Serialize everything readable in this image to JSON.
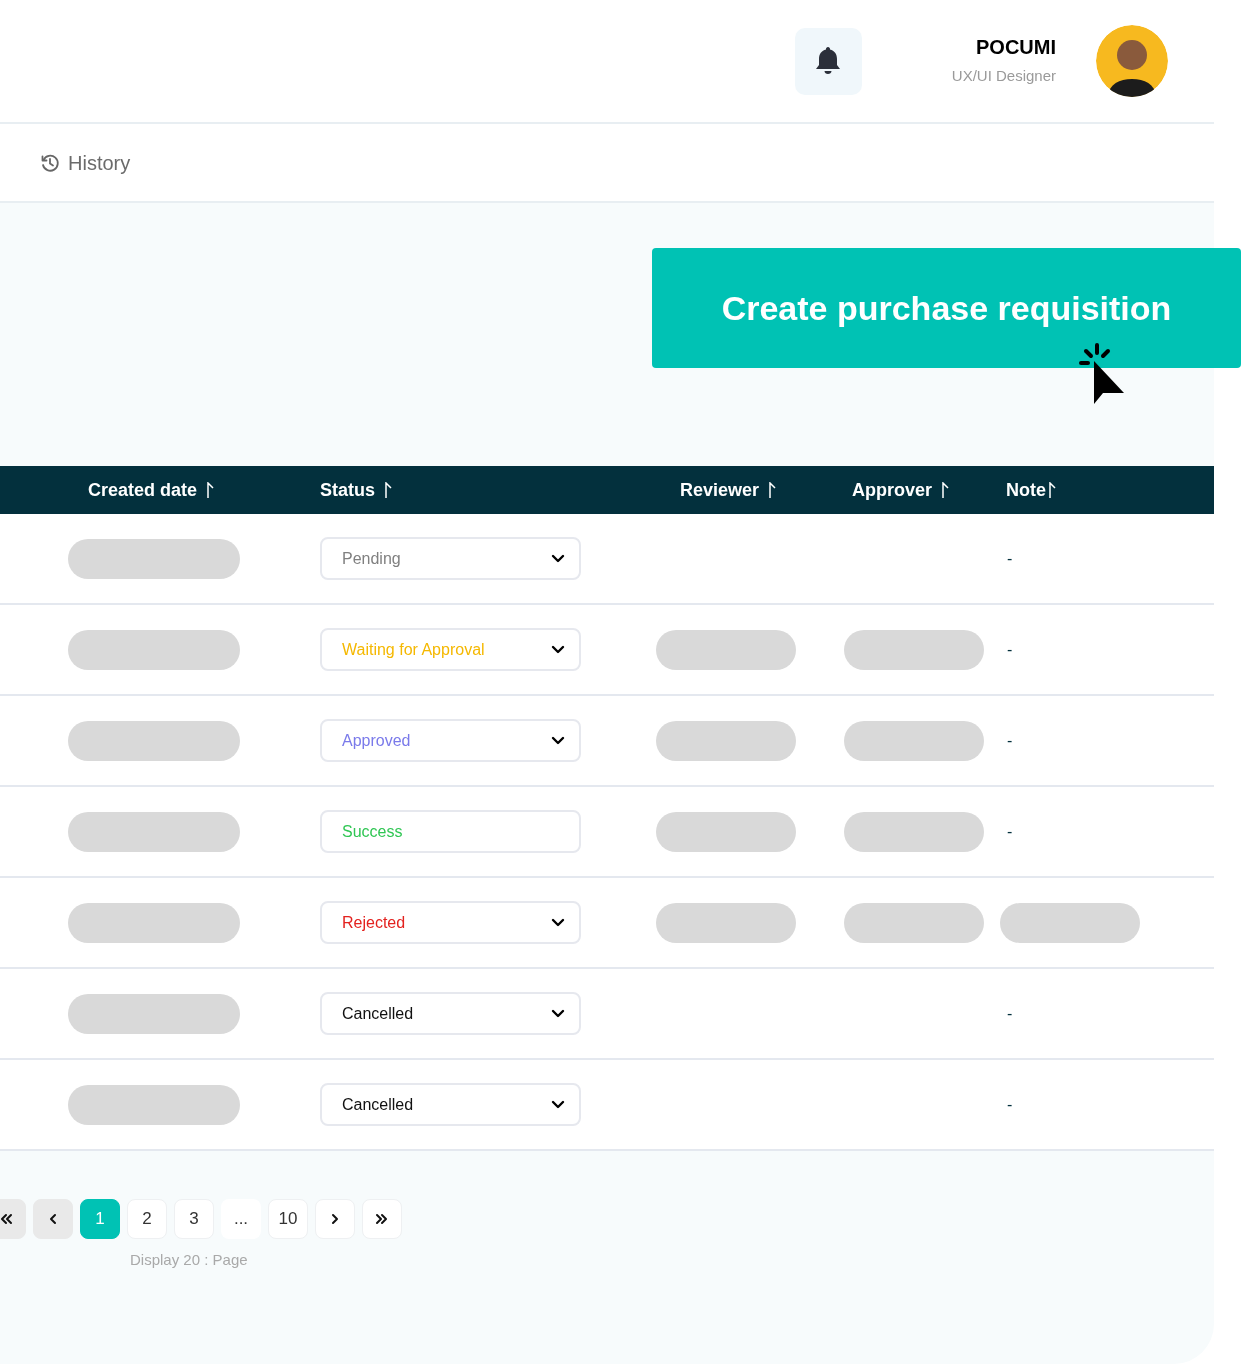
{
  "header": {
    "user_name": "POCUMI",
    "user_role": "UX/UI Designer"
  },
  "breadcrumb": {
    "label": "History"
  },
  "create_button": {
    "label": "Create purchase requisition"
  },
  "table": {
    "columns": [
      "Created date",
      "Status",
      "Reviewer",
      "Approver",
      "Note"
    ],
    "rows": [
      {
        "created": {
          "kind": "skeleton"
        },
        "status": {
          "label": "Pending",
          "color": "#808080",
          "dropdown": true
        },
        "note": {
          "kind": "text",
          "text": "-"
        }
      },
      {
        "created": {
          "kind": "skeleton"
        },
        "status": {
          "label": "Waiting for Approval",
          "color": "#f5b800",
          "dropdown": true
        },
        "reviewer": {
          "kind": "skeleton"
        },
        "approver": {
          "kind": "skeleton"
        },
        "note": {
          "kind": "text",
          "text": "-"
        }
      },
      {
        "created": {
          "kind": "skeleton"
        },
        "status": {
          "label": "Approved",
          "color": "#7a7aea",
          "dropdown": true
        },
        "reviewer": {
          "kind": "skeleton"
        },
        "approver": {
          "kind": "skeleton"
        },
        "note": {
          "kind": "text",
          "text": "-"
        }
      },
      {
        "created": {
          "kind": "skeleton"
        },
        "status": {
          "label": "Success",
          "color": "#2fc653",
          "dropdown": false
        },
        "reviewer": {
          "kind": "skeleton"
        },
        "approver": {
          "kind": "skeleton"
        },
        "note": {
          "kind": "text",
          "text": "-"
        }
      },
      {
        "created": {
          "kind": "skeleton"
        },
        "status": {
          "label": "Rejected",
          "color": "#e3221f",
          "dropdown": true
        },
        "reviewer": {
          "kind": "skeleton"
        },
        "approver": {
          "kind": "skeleton"
        },
        "note": {
          "kind": "skeleton"
        }
      },
      {
        "created": {
          "kind": "skeleton"
        },
        "status": {
          "label": "Cancelled",
          "color": "#111111",
          "dropdown": true
        },
        "note": {
          "kind": "text",
          "text": "-"
        }
      },
      {
        "created": {
          "kind": "skeleton"
        },
        "status": {
          "label": "Cancelled",
          "color": "#111111",
          "dropdown": true
        },
        "note": {
          "kind": "text",
          "text": "-"
        }
      }
    ]
  },
  "pagination": {
    "items": [
      {
        "kind": "first",
        "disabled": true
      },
      {
        "kind": "prev",
        "disabled": true
      },
      {
        "kind": "page",
        "label": "1",
        "selected": true
      },
      {
        "kind": "page",
        "label": "2",
        "selected": false
      },
      {
        "kind": "page",
        "label": "3",
        "selected": false
      },
      {
        "kind": "ellipsis",
        "label": "..."
      },
      {
        "kind": "page",
        "label": "10",
        "selected": false
      },
      {
        "kind": "next",
        "disabled": false
      },
      {
        "kind": "last",
        "disabled": false
      }
    ],
    "summary": "Display 20 : Page"
  }
}
